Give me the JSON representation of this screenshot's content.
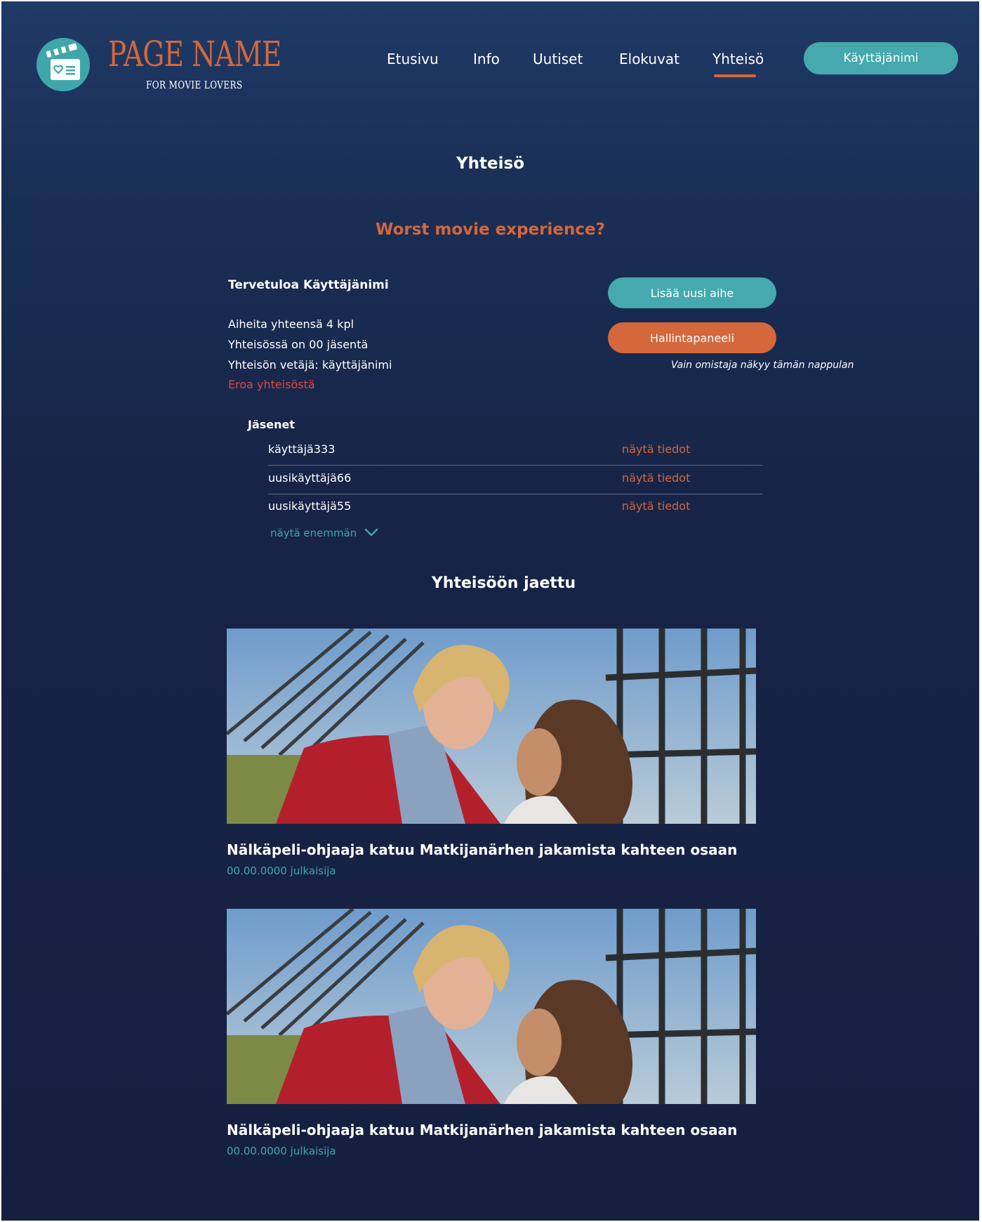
{
  "header": {
    "brand": "PAGE NAME",
    "tagline": "FOR MOVIE LOVERS",
    "nav": [
      "Etusivu",
      "Info",
      "Uutiset",
      "Elokuvat",
      "Yhteisö"
    ],
    "active_nav": "Yhteisö",
    "user_button": "Käyttäjänimi",
    "colors": {
      "accent": "#d4673b",
      "teal": "#45a9ad"
    }
  },
  "page": {
    "title": "Yhteisö",
    "topic_title": "Worst movie experience?"
  },
  "info": {
    "welcome": "Tervetuloa Käyttäjänimi",
    "topics_count": "Aiheita yhteensä 4 kpl",
    "members_count": "Yhteisössä on 00 jäsentä",
    "leader": "Yhteisön vetäjä: käyttäjänimi",
    "leave": "Eroa yhteisöstä"
  },
  "actions": {
    "add_topic": "Lisää uusi aihe",
    "admin_panel": "Hallintapaneeli",
    "owner_note": "Vain omistaja näkyy tämän nappulan"
  },
  "members": {
    "title": "Jäsenet",
    "items": [
      {
        "name": "käyttäjä333",
        "link": "näytä tiedot"
      },
      {
        "name": "uusikäyttäjä66",
        "link": "näytä tiedot"
      },
      {
        "name": "uusikäyttäjä55",
        "link": "näytä tiedot"
      }
    ],
    "show_more": "näytä enemmän"
  },
  "shared": {
    "title": "Yhteisöön jaettu",
    "posts": [
      {
        "title": "Nälkäpeli-ohjaaja katuu Matkijanärhen jakamista kahteen osaan",
        "meta": "00.00.0000 julkaisija"
      },
      {
        "title": "Nälkäpeli-ohjaaja katuu Matkijanärhen jakamista kahteen osaan",
        "meta": "00.00.0000 julkaisija"
      }
    ]
  }
}
